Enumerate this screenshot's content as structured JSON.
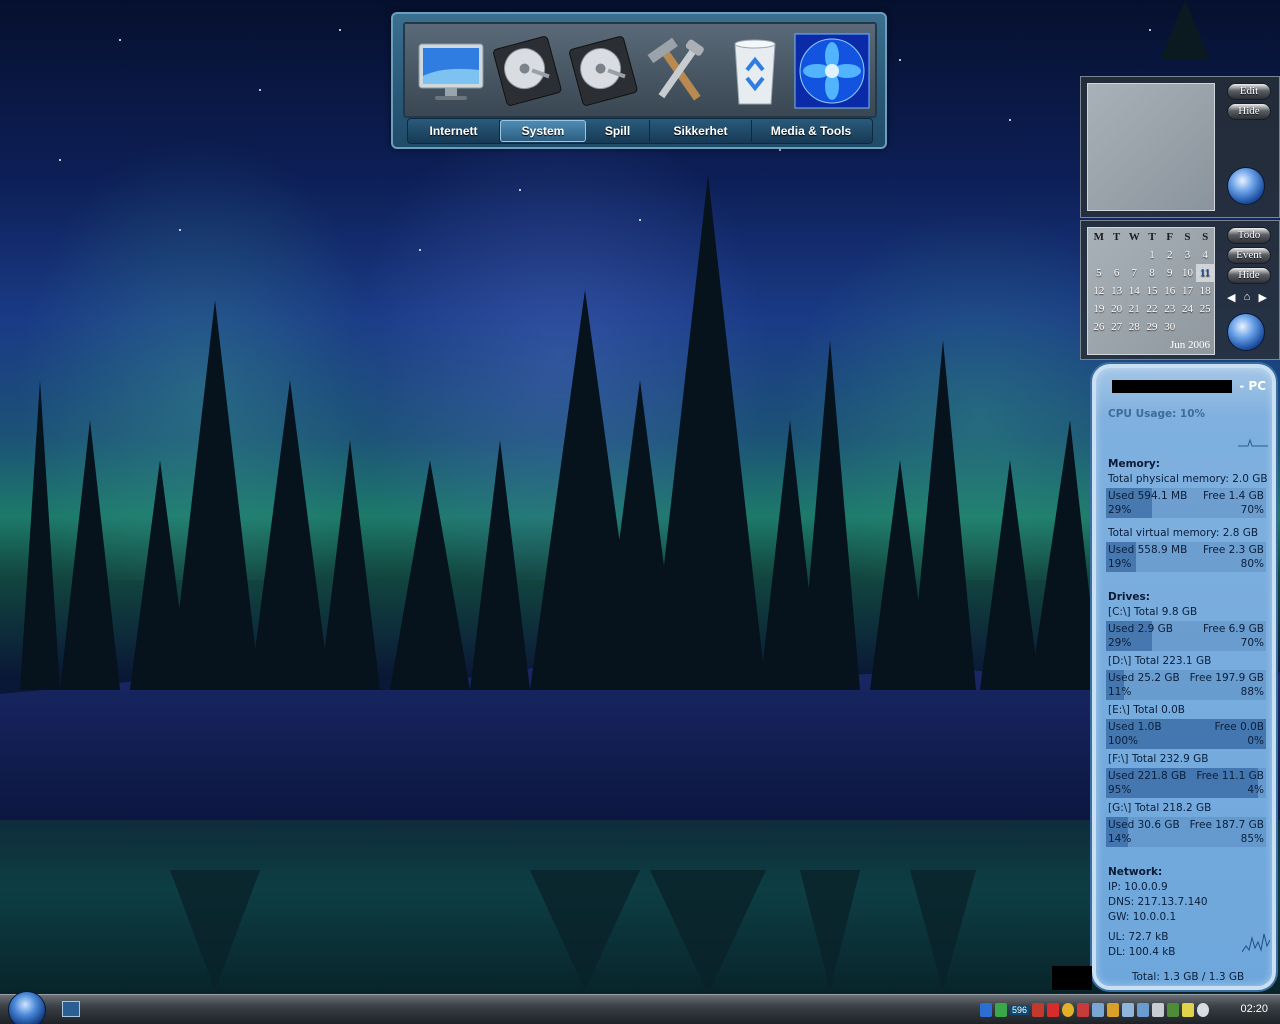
{
  "dock": {
    "icons": [
      {
        "name": "monitor-icon"
      },
      {
        "name": "hard-drive-icon"
      },
      {
        "name": "hard-drive-icon"
      },
      {
        "name": "tools-icon"
      },
      {
        "name": "recycle-bin-icon"
      },
      {
        "name": "fan-icon"
      }
    ],
    "tabs": [
      "Internett",
      "System",
      "Spill",
      "Sikkerhet",
      "Media & Tools"
    ],
    "active_tab": "System"
  },
  "slideshow": {
    "edit_label": "Edit",
    "hide_label": "Hide"
  },
  "calendar": {
    "weekdays": [
      "M",
      "T",
      "W",
      "T",
      "F",
      "S",
      "S"
    ],
    "weeks": [
      [
        "",
        "",
        "",
        "1",
        "2",
        "3",
        "4"
      ],
      [
        "5",
        "6",
        "7",
        "8",
        "9",
        "10",
        "11"
      ],
      [
        "12",
        "13",
        "14",
        "15",
        "16",
        "17",
        "18"
      ],
      [
        "19",
        "20",
        "21",
        "22",
        "23",
        "24",
        "25"
      ],
      [
        "26",
        "27",
        "28",
        "29",
        "30",
        "",
        ""
      ]
    ],
    "today": "11",
    "month_label": "Jun 2006",
    "todo_label": "Todo",
    "event_label": "Event",
    "hide_label": "Hide"
  },
  "sysmon": {
    "pc_suffix": "- PC",
    "cpu": "CPU Usage: 10%",
    "memory_heading": "Memory:",
    "physical_total": "Total physical memory: 2.0 GB",
    "physical": {
      "used": "Used 594.1 MB",
      "free": "Free 1.4 GB",
      "used_pct": "29%",
      "free_pct": "70%",
      "fill": 0.29
    },
    "virtual_total": "Total virtual memory: 2.8 GB",
    "virtual": {
      "used": "Used 558.9 MB",
      "free": "Free 2.3 GB",
      "used_pct": "19%",
      "free_pct": "80%",
      "fill": 0.19
    },
    "drives_heading": "Drives:",
    "drives": [
      {
        "total": "[C:\\] Total 9.8 GB",
        "used": "Used 2.9 GB",
        "free": "Free 6.9 GB",
        "used_pct": "29%",
        "free_pct": "70%",
        "fill": 0.29
      },
      {
        "total": "[D:\\] Total 223.1 GB",
        "used": "Used 25.2 GB",
        "free": "Free 197.9 GB",
        "used_pct": "11%",
        "free_pct": "88%",
        "fill": 0.11
      },
      {
        "total": "[E:\\] Total 0.0B",
        "used": "Used 1.0B",
        "free": "Free 0.0B",
        "used_pct": "100%",
        "free_pct": "0%",
        "fill": 1.0
      },
      {
        "total": "[F:\\] Total 232.9 GB",
        "used": "Used 221.8 GB",
        "free": "Free 11.1 GB",
        "used_pct": "95%",
        "free_pct": "4%",
        "fill": 0.95
      },
      {
        "total": "[G:\\] Total 218.2 GB",
        "used": "Used 30.6 GB",
        "free": "Free 187.7 GB",
        "used_pct": "14%",
        "free_pct": "85%",
        "fill": 0.14
      }
    ],
    "network_heading": "Network:",
    "ip": "IP:     10.0.0.9",
    "dns": "DNS: 217.13.7.140",
    "gw": "GW:   10.0.0.1",
    "ul": "UL: 72.7 kB",
    "dl": "DL: 100.4 kB",
    "total": "Total: 1.3 GB / 1.3 GB"
  },
  "taskbar": {
    "tray_number": "596",
    "clock": "02:20",
    "colors": {
      "accent": "#6ea7dc",
      "taskbar": "#3a3f45"
    }
  }
}
